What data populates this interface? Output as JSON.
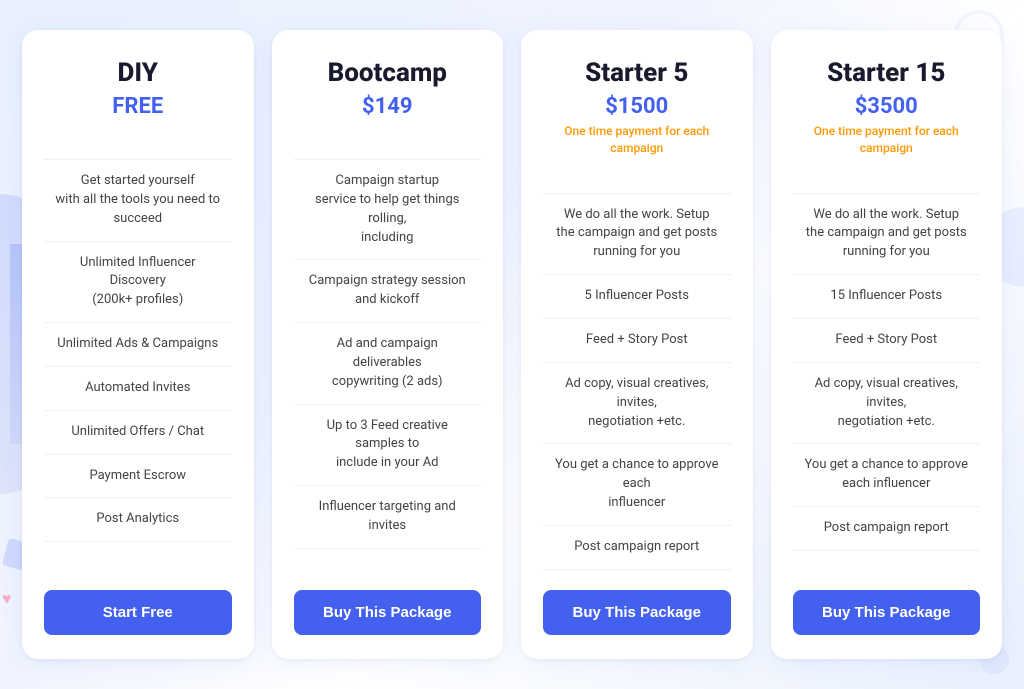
{
  "plans": [
    {
      "id": "diy",
      "name": "DIY",
      "price": "FREE",
      "note": "",
      "features": [
        "Get started yourself\nwith all the tools you need to\nsucceed",
        "Unlimited Influencer Discovery\n(200k+ profiles)",
        "Unlimited Ads & Campaigns",
        "Automated Invites",
        "Unlimited Offers / Chat",
        "Payment Escrow",
        "Post Analytics"
      ],
      "cta": "Start Free"
    },
    {
      "id": "bootcamp",
      "name": "Bootcamp",
      "price": "$149",
      "note": "",
      "features": [
        "Campaign startup\nservice to help get things rolling,\nincluding",
        "Campaign strategy session\nand kickoff",
        "Ad and campaign deliverables\ncopywriting (2 ads)",
        "Up to 3 Feed creative samples to\ninclude in your Ad",
        "Influencer targeting and invites"
      ],
      "cta": "Buy This Package"
    },
    {
      "id": "starter5",
      "name": "Starter 5",
      "price": "$1500",
      "note": "One time payment for each\ncampaign",
      "features": [
        "We do all the work. Setup\nthe campaign and get posts\nrunning for you",
        "5 Influencer Posts",
        "Feed + Story Post",
        "Ad copy, visual creatives, invites,\nnegotiation +etc.",
        "You get a chance to approve each\ninfluencer",
        "Post campaign report"
      ],
      "cta": "Buy This Package"
    },
    {
      "id": "starter15",
      "name": "Starter 15",
      "price": "$3500",
      "note": "One time payment for each\ncampaign",
      "features": [
        "We do all the work. Setup\nthe campaign and get posts\nrunning for you",
        "15 Influencer Posts",
        "Feed + Story Post",
        "Ad copy, visual creatives, invites,\nnegotiation +etc.",
        "You get a chance to approve\neach influencer",
        "Post campaign report"
      ],
      "cta": "Buy This Package"
    }
  ]
}
